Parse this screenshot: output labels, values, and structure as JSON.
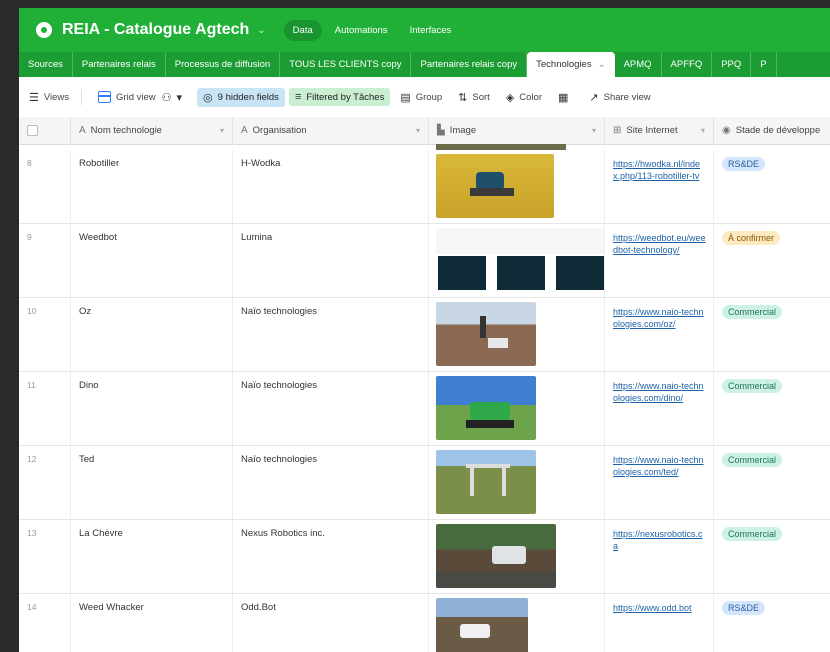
{
  "header": {
    "base_title": "REIA - Catalogue Agtech",
    "nav": [
      "Data",
      "Automations",
      "Interfaces"
    ]
  },
  "tabs": [
    "Sources",
    "Partenaires relais",
    "Processus de diffusion",
    "TOUS LES CLIENTS copy",
    "Partenaires relais copy",
    "Technologies",
    "APMQ",
    "APFFQ",
    "PPQ",
    "P"
  ],
  "active_tab": "Technologies",
  "toolbar": {
    "views": "Views",
    "grid_view": "Grid view",
    "hidden_fields": "9 hidden fields",
    "filtered": "Filtered by Tâches",
    "group": "Group",
    "sort": "Sort",
    "color": "Color",
    "share": "Share view"
  },
  "columns": {
    "nom": "Nom technologie",
    "org": "Organisation",
    "image": "Image",
    "site": "Site Internet",
    "stade": "Stade de développe"
  },
  "rows": [
    {
      "num": "8",
      "nom": "Robotiller",
      "org": "H-Wodka",
      "site": "https://hwodka.nl/index.php/113-robotiller-tv",
      "stade": "RS&DE",
      "stade_color": "#d4e6fb",
      "stade_text": "#2a5d9f"
    },
    {
      "num": "9",
      "nom": "Weedbot",
      "org": "Lumina",
      "site": "https://weedbot.eu/weedbot-technology/",
      "stade": "À confirmer",
      "stade_color": "#fde9c2",
      "stade_text": "#8a5a00"
    },
    {
      "num": "10",
      "nom": "Oz",
      "org": "Naïo technologies",
      "site": "https://www.naio-technologies.com/oz/",
      "stade": "Commercial",
      "stade_color": "#cdf1e6",
      "stade_text": "#1d7358"
    },
    {
      "num": "11",
      "nom": "Dino",
      "org": "Naïo technologies",
      "site": "https://www.naio-technologies.com/dino/",
      "stade": "Commercial",
      "stade_color": "#cdf1e6",
      "stade_text": "#1d7358"
    },
    {
      "num": "12",
      "nom": "Ted",
      "org": "Naïo technologies",
      "site": "https://www.naio-technologies.com/ted/",
      "stade": "Commercial",
      "stade_color": "#cdf1e6",
      "stade_text": "#1d7358"
    },
    {
      "num": "13",
      "nom": "La Chèvre",
      "org": "Nexus Robotics inc.",
      "site": "https://nexusrobotics.ca",
      "stade": "Commercial",
      "stade_color": "#cdf1e6",
      "stade_text": "#1d7358"
    },
    {
      "num": "14",
      "nom": "Weed Whacker",
      "org": "Odd.Bot",
      "site": "https://www.odd.bot",
      "stade": "RS&DE",
      "stade_color": "#d4e6fb",
      "stade_text": "#2a5d9f"
    }
  ],
  "colors": {
    "brand": "#20b038",
    "tabbar": "#1c9d33",
    "link": "#1e63a8"
  }
}
